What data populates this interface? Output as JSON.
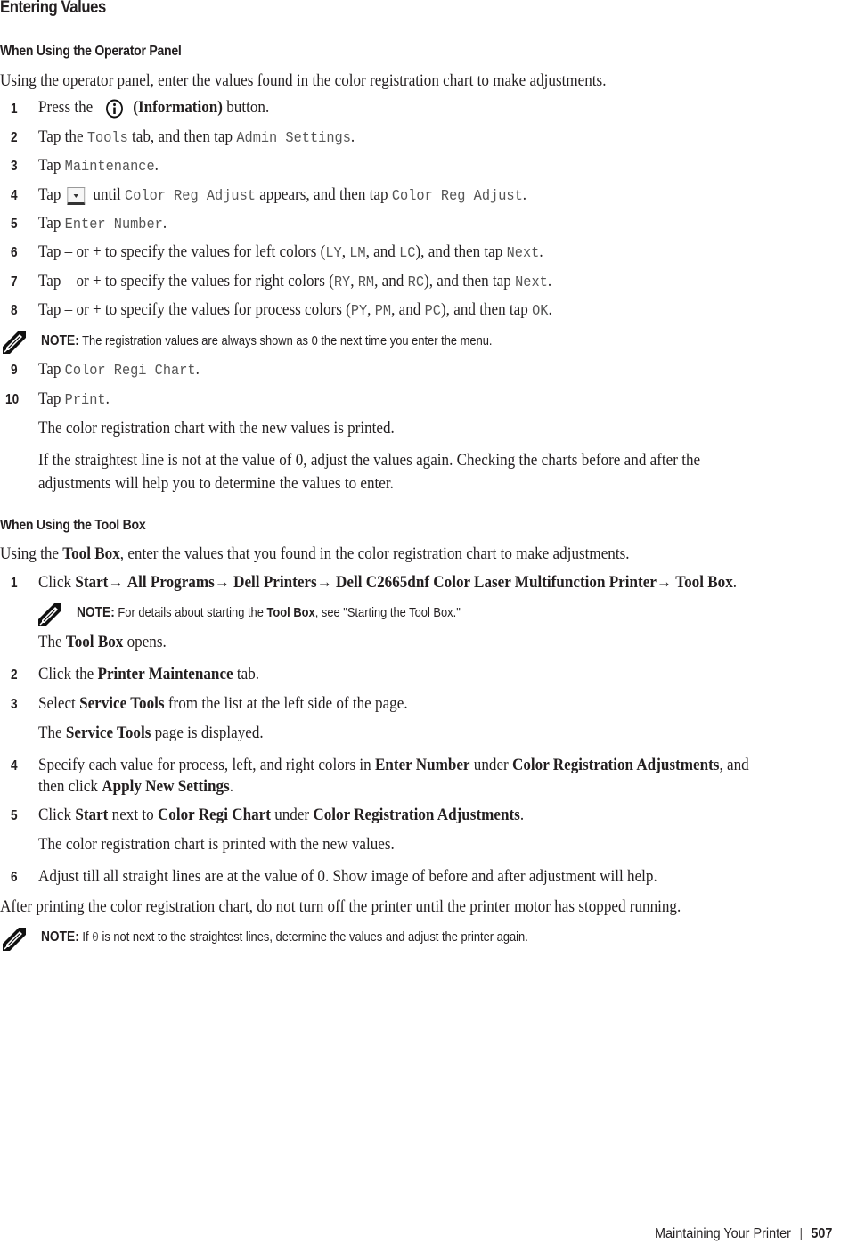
{
  "title": "Entering Values",
  "section1": {
    "heading": "When Using the Operator Panel",
    "intro": "Using the operator panel, enter the values found in the color registration chart to make adjustments.",
    "steps": [
      {
        "n": "1",
        "pre": "Press the",
        "icon": "info-icon",
        "bold": "(Information)",
        "post": " button."
      },
      {
        "n": "2",
        "t1": "Tap the ",
        "c1": "Tools",
        "t2": " tab, and then tap ",
        "c2": "Admin Settings",
        "t3": "."
      },
      {
        "n": "3",
        "t1": "Tap ",
        "c1": "Maintenance",
        "t2": "."
      },
      {
        "n": "4",
        "t1": "Tap",
        "icon": "down-arrow-button-icon",
        "t2": "until ",
        "c1": "Color Reg Adjust",
        "t3": " appears, and then tap ",
        "c2": "Color Reg Adjust",
        "t4": "."
      },
      {
        "n": "5",
        "t1": "Tap ",
        "c1": "Enter Number",
        "t2": "."
      },
      {
        "n": "6",
        "t1": "Tap – or + to specify the values for left colors (",
        "c1": "LY",
        "t2": ", ",
        "c2": "LM",
        "t3": ", and ",
        "c3": "LC",
        "t4": "), and then tap ",
        "c4": "Next",
        "t5": "."
      },
      {
        "n": "7",
        "t1": "Tap – or + to specify the values for right colors (",
        "c1": "RY",
        "t2": ", ",
        "c2": "RM",
        "t3": ", and ",
        "c3": "RC",
        "t4": "), and then tap ",
        "c4": "Next",
        "t5": "."
      },
      {
        "n": "8",
        "t1": "Tap – or + to specify the values for process colors (",
        "c1": "PY",
        "t2": ", ",
        "c2": "PM",
        "t3": ", and ",
        "c3": "PC",
        "t4": "), and then tap ",
        "c4": "OK",
        "t5": "."
      },
      {
        "n": "9",
        "t1": "Tap ",
        "c1": "Color Regi Chart",
        "t2": "."
      },
      {
        "n": "10",
        "t1": "Tap ",
        "c1": "Print",
        "t2": "."
      }
    ],
    "note": {
      "label": "NOTE:",
      "text": " The registration values are always shown as 0 the next time you enter the menu."
    },
    "after1": "The color registration chart with the new values is printed.",
    "after2a": "If the straightest line is not at the value of 0, adjust the values again. Checking the charts before and after the",
    "after2b": "adjustments will help you to determine the values to enter."
  },
  "section2": {
    "heading": "When Using the Tool Box",
    "intro_pre": "Using the ",
    "intro_bold": "Tool Box",
    "intro_post": ", enter the values that you found in the color registration chart to make adjustments.",
    "step1": {
      "n": "1",
      "pre": "Click ",
      "path": [
        "Start",
        "All Programs",
        "Dell Printers",
        "Dell C2665dnf Color Laser Multifunction Printer",
        "Tool Box"
      ],
      "arrow": "→ ",
      "post": "."
    },
    "note1": {
      "label": "NOTE:",
      "pre": " For details about starting the ",
      "bold": "Tool Box",
      "post": ", see \"Starting the Tool Box.\""
    },
    "opens": {
      "pre": "The ",
      "bold": "Tool Box",
      "post": " opens."
    },
    "step2": {
      "n": "2",
      "pre": "Click the ",
      "bold": "Printer Maintenance",
      "post": " tab."
    },
    "step3": {
      "n": "3",
      "pre": "Select ",
      "bold": "Service Tools",
      "post": " from the list at the left side of the page."
    },
    "displayed": {
      "pre": "The ",
      "bold": "Service Tools",
      "post": " page is displayed."
    },
    "step4": {
      "n": "4",
      "pre": "Specify each value for process, left, and right colors in ",
      "b1": "Enter Number",
      "mid": " under ",
      "b2": "Color Registration Adjustments",
      "post": ", and",
      "line2pre": "then click ",
      "b3": "Apply New Settings",
      "line2post": "."
    },
    "step5": {
      "n": "5",
      "pre": "Click ",
      "b1": "Start",
      "mid1": " next to ",
      "b2": "Color Regi Chart",
      "mid2": " under ",
      "b3": "Color Registration Adjustments",
      "post": "."
    },
    "printed": "The color registration chart is printed with the new values.",
    "step6": {
      "n": "6",
      "text": "Adjust till all straight lines are at the value of 0. Show image of before and after adjustment will help."
    },
    "after": "After printing the color registration chart, do not turn off the printer until the printer motor has stopped running.",
    "note2": {
      "label": "NOTE:",
      "pre": " If ",
      "code": "0",
      "post": " is not next to the straightest lines, determine the values and adjust the printer again."
    }
  },
  "footer": {
    "section": "Maintaining Your Printer",
    "page": "507"
  }
}
